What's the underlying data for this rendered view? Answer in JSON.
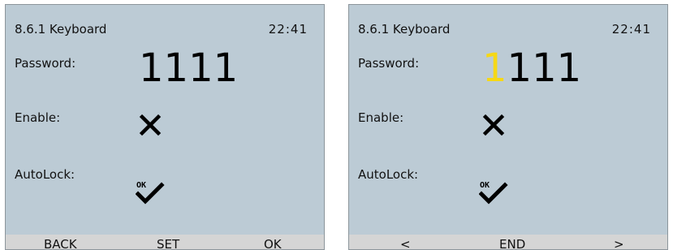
{
  "screens": [
    {
      "title": "8.6.1 Keyboard",
      "time": "22:41",
      "password_label": "Password:",
      "password_value": "1111",
      "enable_label": "Enable:",
      "enable_state": "disabled",
      "autolock_label": "AutoLock:",
      "autolock_state": "enabled",
      "softkeys": [
        "BACK",
        "SET",
        "OK"
      ]
    },
    {
      "title": "8.6.1 Keyboard",
      "time": "22:41",
      "password_label": "Password:",
      "password_cursor_digit": "1",
      "password_rest": "111",
      "enable_label": "Enable:",
      "enable_state": "disabled",
      "autolock_label": "AutoLock:",
      "autolock_state": "enabled",
      "softkeys": [
        "<",
        "END",
        ">"
      ]
    }
  ],
  "icons": {
    "enable": "cross-icon",
    "autolock": "ok-check-icon"
  },
  "colors": {
    "screen_bg": "#bccbd5",
    "softkey_bar": "#d5d5d5",
    "cursor_digit": "#f6d816"
  }
}
